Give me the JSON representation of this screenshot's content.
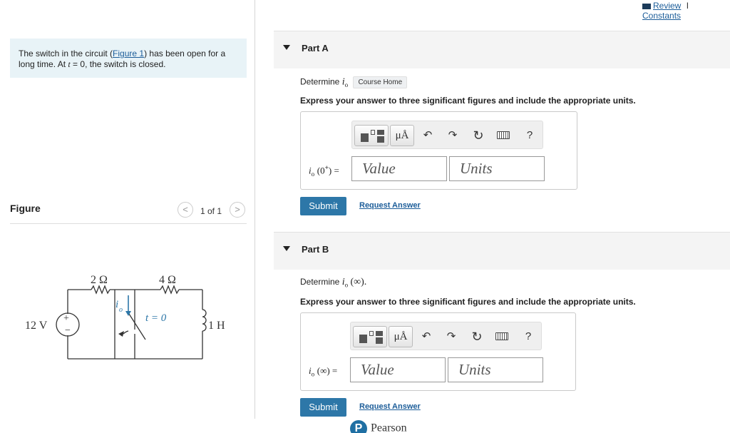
{
  "top_links": {
    "review": "Review",
    "separator": "I",
    "constants": "Constants"
  },
  "problem": {
    "text_before": "The switch in the circuit (",
    "figure_link": "Figure 1",
    "text_mid": ") has been open for a long time. At ",
    "t_var": "t",
    "text_after": " = 0, the switch is closed."
  },
  "figure_panel": {
    "title": "Figure",
    "pager": "1 of 1",
    "prev": "<",
    "next": ">"
  },
  "circuit": {
    "r1": "2 Ω",
    "r2": "4 Ω",
    "source": "12 V",
    "inductor": "1 H",
    "switch_label": "t = 0",
    "current_label": "i",
    "current_sub": "o",
    "plus": "+",
    "minus": "−"
  },
  "part_a": {
    "title": "Part A",
    "determine": "Determine",
    "var": "i",
    "var_sub": "o",
    "course_home": "Course Home",
    "express": "Express your answer to three significant figures and include the appropriate units.",
    "label": "(0",
    "label_sup": "+",
    "label_end": ") =",
    "value_placeholder": "Value",
    "units_placeholder": "Units",
    "submit": "Submit",
    "request": "Request Answer"
  },
  "part_b": {
    "title": "Part B",
    "determine": "Determine",
    "var": "i",
    "var_sub": "o",
    "arg": "(∞).",
    "express": "Express your answer to three significant figures and include the appropriate units.",
    "label": "(∞) =",
    "value_placeholder": "Value",
    "units_placeholder": "Units",
    "submit": "Submit",
    "request": "Request Answer"
  },
  "toolbar": {
    "template_icon": "templates-icon",
    "units_glyph": "μÅ",
    "undo": "↶",
    "redo": "↷",
    "reset": "↻",
    "help": "?"
  },
  "footer": {
    "brand": "Pearson",
    "logo_letter": "P"
  }
}
